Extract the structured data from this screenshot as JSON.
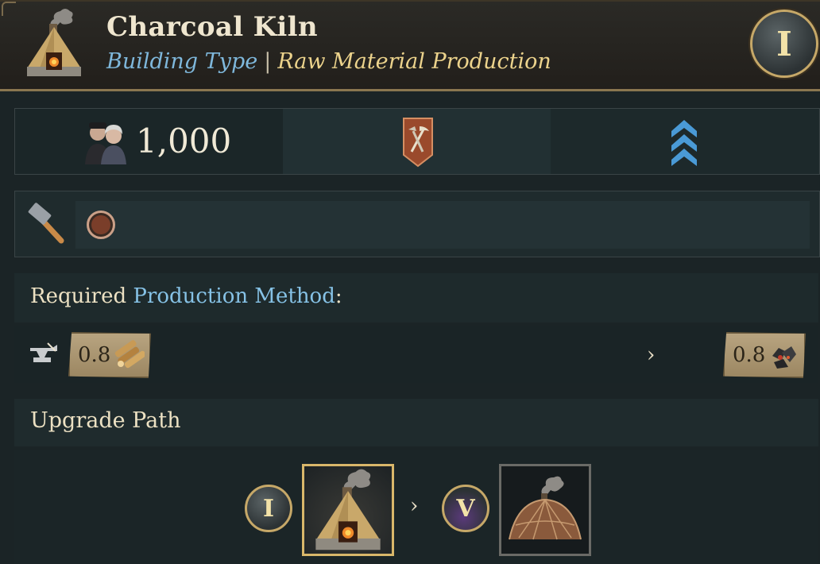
{
  "header": {
    "title": "Charcoal Kiln",
    "subtitle_type": "Building Type",
    "subtitle_sep": "|",
    "subtitle_category": "Raw Material Production",
    "era": "I"
  },
  "stats": {
    "population": "1,000"
  },
  "production": {
    "required_label": "Required",
    "method_label": "Production Method",
    "colon": ":",
    "input_amount": "0.8",
    "input_good_icon": "lumber-icon",
    "output_amount": "0.8",
    "output_good_icon": "charcoal-icon",
    "arrow": "›"
  },
  "upgrade": {
    "title": "Upgrade Path",
    "steps": [
      {
        "era": "I",
        "building_icon": "charcoal-kiln-icon"
      },
      {
        "era": "V",
        "building_icon": "charcoal-pile-icon"
      }
    ],
    "arrow": "›"
  },
  "colors": {
    "accent_blue": "#7fb8dc",
    "accent_gold": "#ecd38c",
    "border_gold": "#c6a868"
  }
}
